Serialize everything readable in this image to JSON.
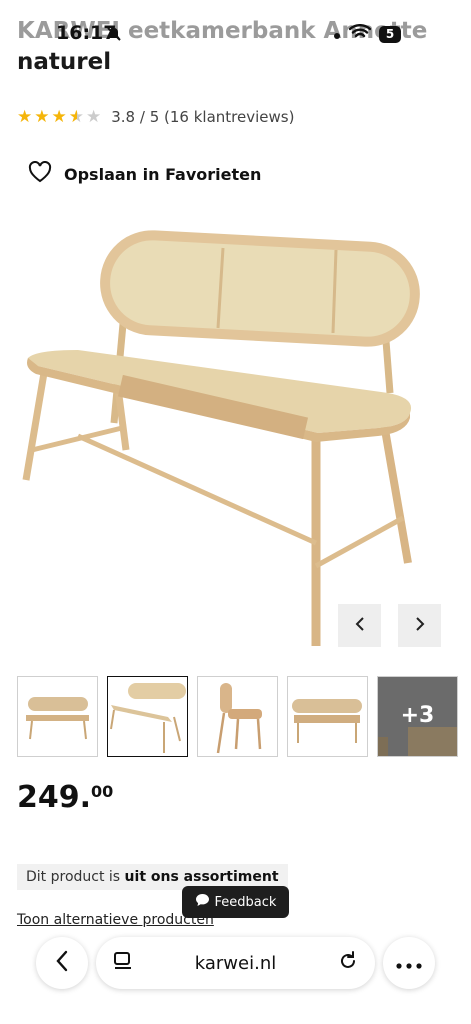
{
  "status_bar": {
    "time": "16:17",
    "battery": "5"
  },
  "product": {
    "title_line1": "KARWEI eetkamerbank Annette",
    "title_line2": "naturel",
    "rating_text": "3.8 / 5 (16 klantreviews)",
    "rating_value": 3.8,
    "favorite_label": "Opslaan in Favorieten",
    "price_main": "249.",
    "price_cents": "00",
    "assortment_prefix": "Dit product is ",
    "assortment_bold": "uit ons assortiment",
    "alternatives_link": "Toon alternatieve producten",
    "more_images_label": "+3"
  },
  "feedback_label": "Feedback",
  "browser": {
    "url": "karwei.nl"
  },
  "colors": {
    "star": "#f5b50a",
    "star_empty": "#cccccc",
    "wood": "#e3c9a0",
    "rattan": "#e6d6ae"
  }
}
